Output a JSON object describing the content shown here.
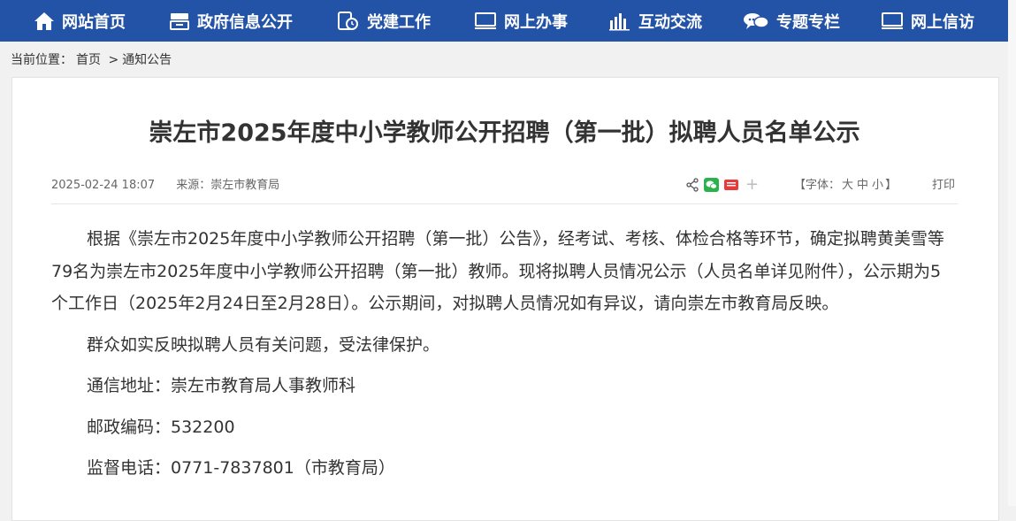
{
  "nav": {
    "items": [
      {
        "label": "网站首页",
        "icon": "home-icon"
      },
      {
        "label": "政府信息公开",
        "icon": "document-tray-icon"
      },
      {
        "label": "党建工作",
        "icon": "clock-document-icon"
      },
      {
        "label": "网上办事",
        "icon": "monitor-icon"
      },
      {
        "label": "互动交流",
        "icon": "bar-chart-icon"
      },
      {
        "label": "专题专栏",
        "icon": "chat-bubble-icon"
      },
      {
        "label": "网上信访",
        "icon": "monitor-icon"
      }
    ]
  },
  "breadcrumb": {
    "prefix": "当前位置：",
    "home": "首页",
    "separator": ">",
    "current": "通知公告"
  },
  "article": {
    "title": "崇左市2025年度中小学教师公开招聘（第一批）拟聘人员名单公示",
    "date": "2025-02-24 18:07",
    "source": "来源：崇左市教育局",
    "font_label": "【字体：",
    "font_large": "大",
    "font_medium": "中",
    "font_small": "小",
    "font_close": "】",
    "print": "打印",
    "share_more": "+",
    "paragraphs": [
      "根据《崇左市2025年度中小学教师公开招聘（第一批）公告》，经考试、考核、体检合格等环节，确定拟聘黄美雪等79名为崇左市2025年度中小学教师公开招聘（第一批）教师。现将拟聘人员情况公示（人员名单详见附件），公示期为5个工作日（2025年2月24日至2月28日）。公示期间，对拟聘人员情况如有异议，请向崇左市教育局反映。",
      "群众如实反映拟聘人员有关问题，受法律保护。",
      "通信地址：崇左市教育局人事教师科",
      "邮政编码：532200",
      "监督电话：0771-7837801（市教育局）"
    ]
  },
  "colors": {
    "nav_bg": "#2353a6",
    "wechat": "#2bb24c",
    "toutiao": "#e83a3a"
  }
}
